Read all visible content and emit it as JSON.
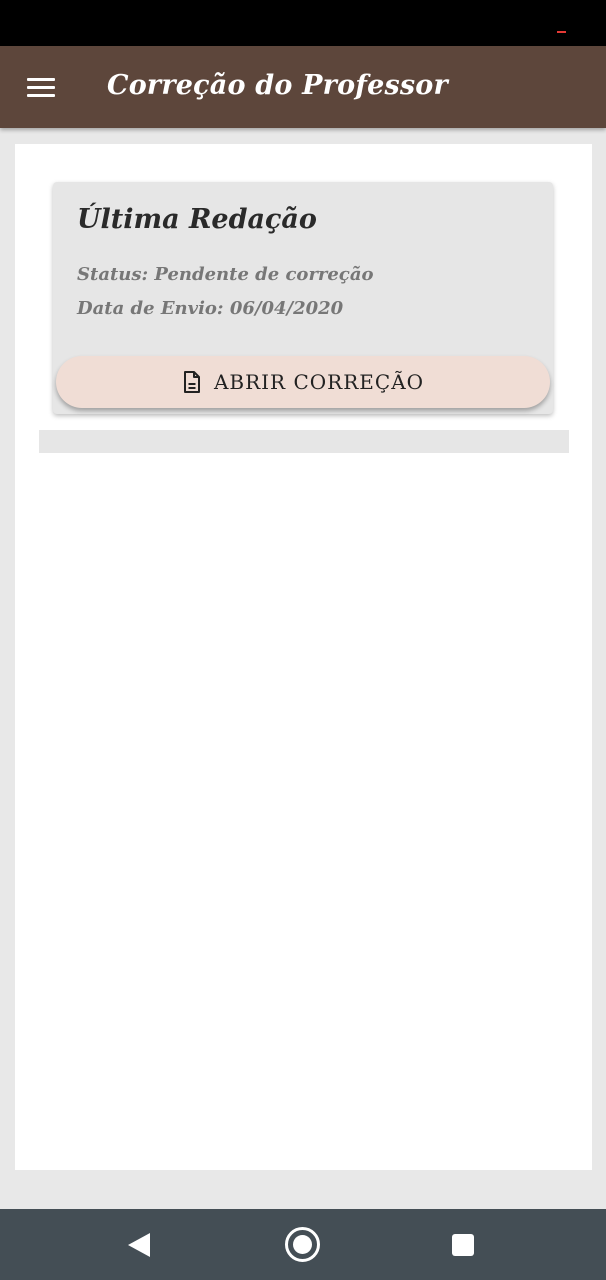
{
  "app_bar": {
    "title": "Correção do Professor",
    "menu_icon": "hamburger-menu-icon",
    "background": "#5d463b"
  },
  "card": {
    "title": "Última Redação",
    "status_line": "Status: Pendente de correção",
    "date_line": "Data de Envio: 06/04/2020",
    "button": {
      "label": "ABRIR CORREÇÃO",
      "icon": "document-icon",
      "background": "#f0ddd5"
    }
  },
  "nav_bar": {
    "back_icon": "back-triangle-icon",
    "home_icon": "home-circle-icon",
    "recent_icon": "recent-apps-square-icon"
  }
}
